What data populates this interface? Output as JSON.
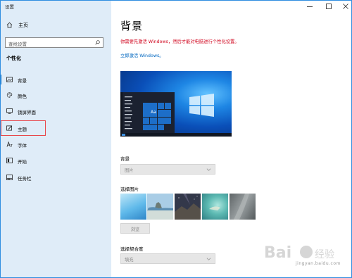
{
  "window": {
    "title": "设置"
  },
  "sidebar": {
    "home_label": "主页",
    "search_placeholder": "查找设置",
    "section_title": "个性化",
    "items": [
      {
        "label": "背景",
        "icon": "picture-icon"
      },
      {
        "label": "颜色",
        "icon": "palette-icon"
      },
      {
        "label": "锁屏界面",
        "icon": "monitor-icon"
      },
      {
        "label": "主题",
        "icon": "brush-icon"
      },
      {
        "label": "字体",
        "icon": "font-icon"
      },
      {
        "label": "开始",
        "icon": "start-icon"
      },
      {
        "label": "任务栏",
        "icon": "taskbar-icon"
      }
    ]
  },
  "main": {
    "title": "背景",
    "warning": "你需要先激活 Windows，然后才能对电脑进行个性化设置。",
    "activate_link": "立即激活 Windows。",
    "preview_tile_text": "Aa",
    "background": {
      "label": "背景",
      "value": "图片"
    },
    "choose_picture": {
      "label": "选择图片"
    },
    "browse_label": "浏览",
    "fit": {
      "label": "选择契合度",
      "value": "填充"
    }
  },
  "watermark": {
    "text": "jingyan.baidu.com"
  },
  "colors": {
    "accent": "#0067c0",
    "warning": "#d0021b",
    "highlight_box": "#e8474c",
    "sidebar_bg": "#dfecf8"
  }
}
